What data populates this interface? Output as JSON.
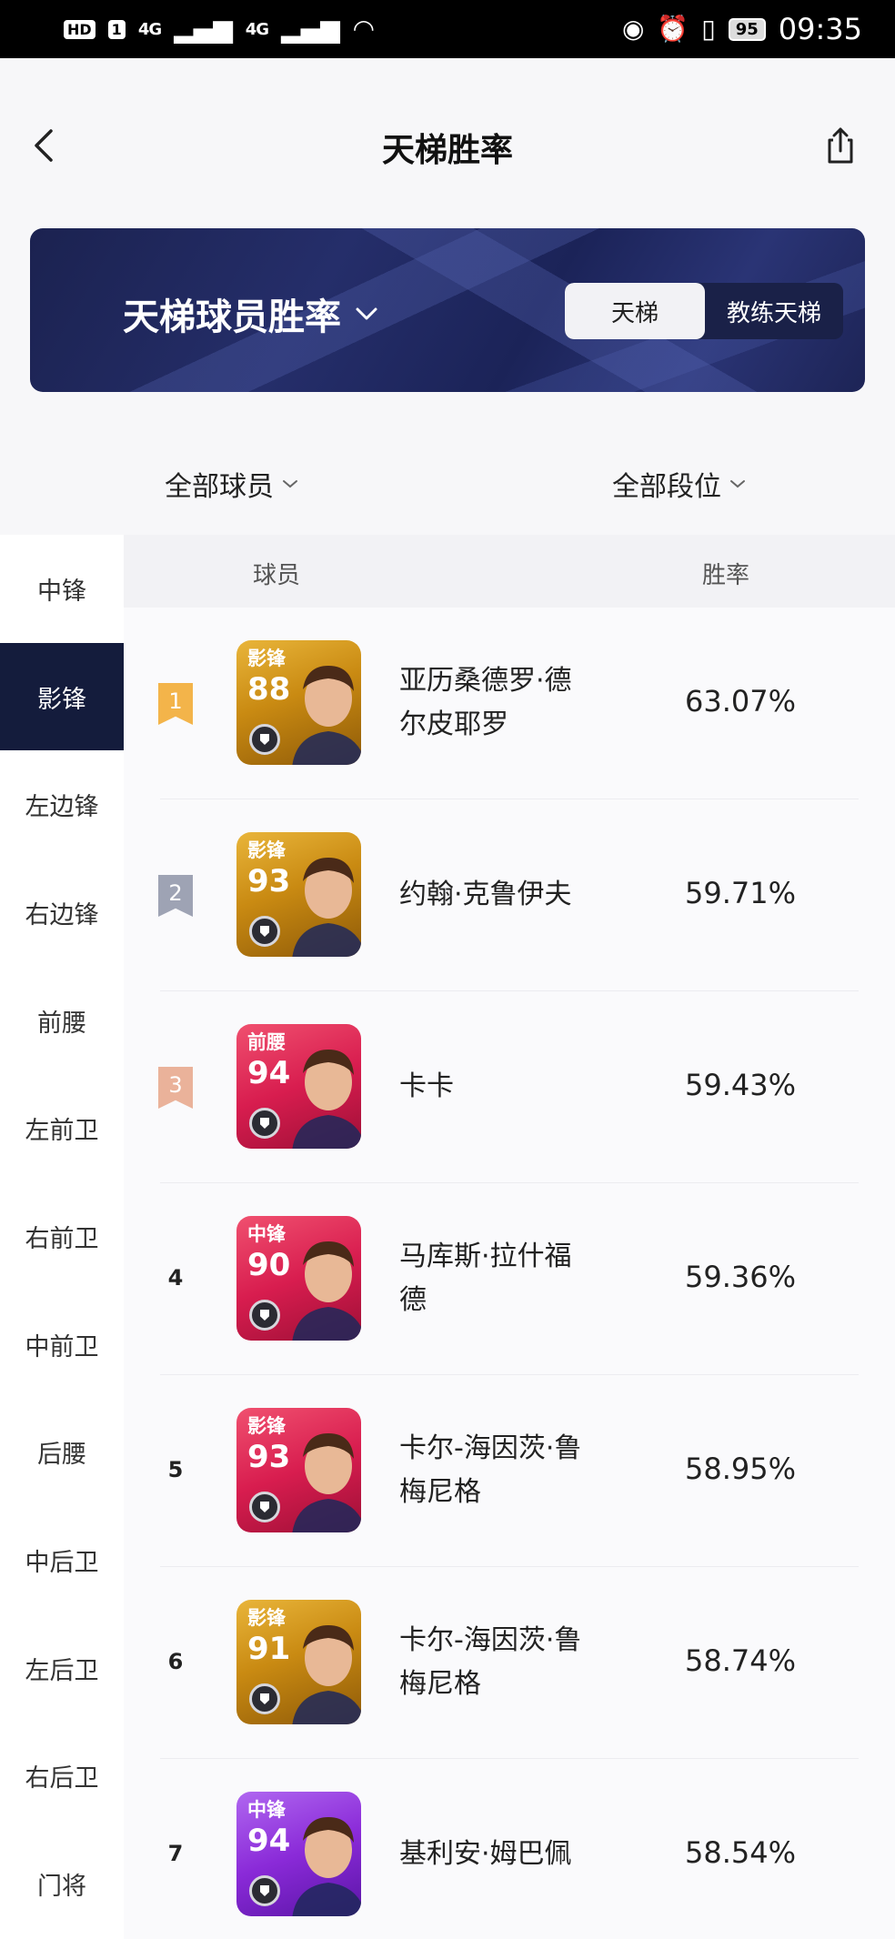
{
  "status_bar": {
    "hd": "HD",
    "sim": "1",
    "net1": "4G",
    "net2": "4G",
    "battery": "95",
    "time": "09:35"
  },
  "header": {
    "title": "天梯胜率"
  },
  "banner": {
    "title": "天梯球员胜率",
    "toggle": [
      "天梯",
      "教练天梯"
    ]
  },
  "filters": {
    "players": "全部球员",
    "tiers": "全部段位"
  },
  "sidebar": {
    "items": [
      "中锋",
      "影锋",
      "左边锋",
      "右边锋",
      "前腰",
      "左前卫",
      "右前卫",
      "中前卫",
      "后腰",
      "中后卫",
      "左后卫",
      "右后卫",
      "门将"
    ],
    "active_index": 1
  },
  "table": {
    "col_player": "球员",
    "col_rate": "胜率",
    "rows": [
      {
        "rank": "1",
        "position": "影锋",
        "rating": "88",
        "name_lines": [
          "亚历桑德罗·德",
          "尔皮耶罗"
        ],
        "win_rate": "63.07%",
        "card_color": "gold"
      },
      {
        "rank": "2",
        "position": "影锋",
        "rating": "93",
        "name_lines": [
          "约翰·克鲁伊夫"
        ],
        "win_rate": "59.71%",
        "card_color": "gold"
      },
      {
        "rank": "3",
        "position": "前腰",
        "rating": "94",
        "name_lines": [
          "卡卡"
        ],
        "win_rate": "59.43%",
        "card_color": "red"
      },
      {
        "rank": "4",
        "position": "中锋",
        "rating": "90",
        "name_lines": [
          "马库斯·拉什福",
          "德"
        ],
        "win_rate": "59.36%",
        "card_color": "red"
      },
      {
        "rank": "5",
        "position": "影锋",
        "rating": "93",
        "name_lines": [
          "卡尔-海因茨·鲁",
          "梅尼格"
        ],
        "win_rate": "58.95%",
        "card_color": "red"
      },
      {
        "rank": "6",
        "position": "影锋",
        "rating": "91",
        "name_lines": [
          "卡尔-海因茨·鲁",
          "梅尼格"
        ],
        "win_rate": "58.74%",
        "card_color": "gold"
      },
      {
        "rank": "7",
        "position": "中锋",
        "rating": "94",
        "name_lines": [
          "基利安·姆巴佩"
        ],
        "win_rate": "58.54%",
        "card_color": "purple"
      }
    ]
  },
  "colors": {
    "rank1": "#f3b44a",
    "rank2": "#9ea3b4",
    "rank3": "#eab29a",
    "sidebar_active": "#141c3c",
    "gold_card": "#c98a12",
    "red_card": "#d81d4f",
    "purple_card": "#8a2ad8"
  }
}
